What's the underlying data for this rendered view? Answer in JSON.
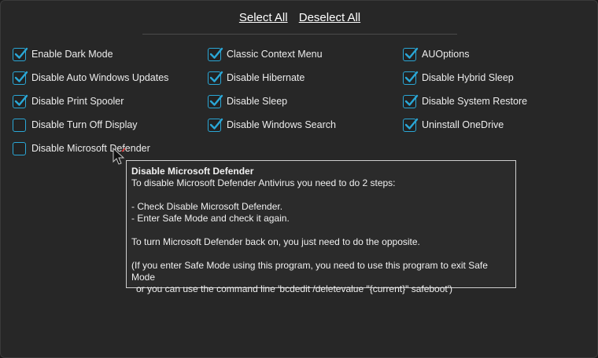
{
  "header": {
    "select_all": "Select All",
    "deselect_all": "Deselect All"
  },
  "colors": {
    "accent": "#2aa7d6",
    "background": "#272727",
    "text": "#ececec"
  },
  "options": [
    {
      "label": "Enable Dark Mode",
      "checked": true
    },
    {
      "label": "Classic Context Menu",
      "checked": true
    },
    {
      "label": "AUOptions",
      "checked": true
    },
    {
      "label": "Disable Auto Windows Updates",
      "checked": true
    },
    {
      "label": "Disable Hibernate",
      "checked": true
    },
    {
      "label": "Disable Hybrid Sleep",
      "checked": true
    },
    {
      "label": "Disable Print Spooler",
      "checked": true
    },
    {
      "label": "Disable Sleep",
      "checked": true
    },
    {
      "label": "Disable System Restore",
      "checked": true
    },
    {
      "label": "Disable Turn Off Display",
      "checked": false
    },
    {
      "label": "Disable Windows Search",
      "checked": true
    },
    {
      "label": "Uninstall OneDrive",
      "checked": true
    },
    {
      "label": "Disable Microsoft Defender",
      "checked": false
    }
  ],
  "tooltip": {
    "title": "Disable Microsoft Defender",
    "line1": "To disable Microsoft Defender Antivirus you need to do 2 steps:",
    "line2": "- Check Disable Microsoft Defender.",
    "line3": "- Enter Safe Mode and check it again.",
    "line4": "To turn Microsoft Defender back on, you just need to do the opposite.",
    "line5": "(If you enter Safe Mode using this program, you need to use this program to exit Safe Mode",
    "line6": "or you can use the command line 'bcdedit /deletevalue \"{current}\" safeboot')"
  }
}
